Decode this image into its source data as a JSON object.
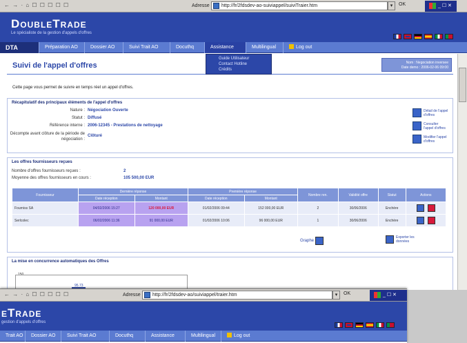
{
  "browser": {
    "address_label": "Adresse",
    "url_main": "http://fr/2fdsdev-ao-suiviappel/suiviTraier.htm",
    "url_back": "http://fr/2fdsdev-ao/suiviappel/traier.htm",
    "go_label": "OK",
    "toolbar_glyphs": "← → · ⌂ ☐ ☐ ☐ ☐ ☐"
  },
  "site": {
    "logo": "DoubleTrade",
    "logo_back": "eTrade",
    "tagline": "Le spécialiste de la gestion d'appels d'offres",
    "tagline_back": "gestion d'appels d'offres",
    "flags": [
      "#c8102e",
      "#1a3c9c",
      "#ffce00",
      "#c8102e",
      "#009246",
      "#c8102e"
    ]
  },
  "nav": {
    "logo": "DTA",
    "items": [
      "Préparation AO",
      "Dossier AO",
      "Suivi Trait AO",
      "Docuthq",
      "Assistance",
      "Multilingual",
      "Log out"
    ],
    "back_items": [
      "Trait AO",
      "Dossier AO",
      "Suivi Trait AO",
      "Docuthq",
      "Assistance",
      "Multilingual",
      "Log out"
    ],
    "assistance_menu": [
      "Guide Utilisateur",
      "Contact Hotline",
      "Crédits"
    ]
  },
  "page": {
    "title": "Suivi de l'appel d'offres",
    "user_line1": "Nom : Negociation inversee",
    "user_line2": "Date demo : 2006-02-06 09:00",
    "intro": "Cette page vous permet de suivre en temps réel un appel d'offres."
  },
  "recap": {
    "heading": "Récapitulatif des principaux éléments de l'appel d'offres",
    "nature_label": "Nature :",
    "nature_value": "Négociation Ouverte",
    "statut_label": "Statut :",
    "statut_value": "Diffusé",
    "ref_label": "Référence interne :",
    "ref_value": "2006-12345 - Prestations de nettoyage",
    "decompte_label": "Décompte avant clôture de la période de négociation :",
    "decompte_value": "Clôturé",
    "actions": [
      "Détail de l'appel d'offres",
      "Consulter l'appel d'offres",
      "Modifier l'appel d'offres"
    ]
  },
  "offers": {
    "heading": "Les offres fournisseurs reçues",
    "count_label": "Nombre d'offres fournisseurs reçues :",
    "count_value": "2",
    "avg_label": "Moyenne des offres fournisseurs en cours :",
    "avg_value": "105 500,00 EUR",
    "group_headers": [
      "Dernière réponse",
      "Première réponse"
    ],
    "columns": [
      "Fournisseur",
      "Date réception",
      "Montant",
      "Date réception",
      "Montant",
      "Nombre ren.",
      "Validité offre",
      "Statut",
      "Actions"
    ],
    "rows": [
      {
        "fournisseur": "Fourniss SA",
        "d1": "04/02/2006 15:27",
        "m1": "120 000,00 EUR",
        "d2": "01/02/2006 09:44",
        "m2": "152 000,00 EUR",
        "nb": "2",
        "val": "30/06/2006",
        "statut": "Enchère"
      },
      {
        "fournisseur": "Serlcolec",
        "d1": "06/02/2006 11:36",
        "m1": "91 000,00 EUR",
        "d2": "01/02/2006 10:06",
        "m2": "96 000,00 EUR",
        "nb": "1",
        "val": "30/06/2006",
        "statut": "Enchère"
      }
    ],
    "graph_label": "Graphe",
    "export_label": "Exporter les données"
  },
  "competition": {
    "heading": "La mise en concurrence automatiques des Offres",
    "y_tick": "150",
    "value_label": "95.73"
  }
}
